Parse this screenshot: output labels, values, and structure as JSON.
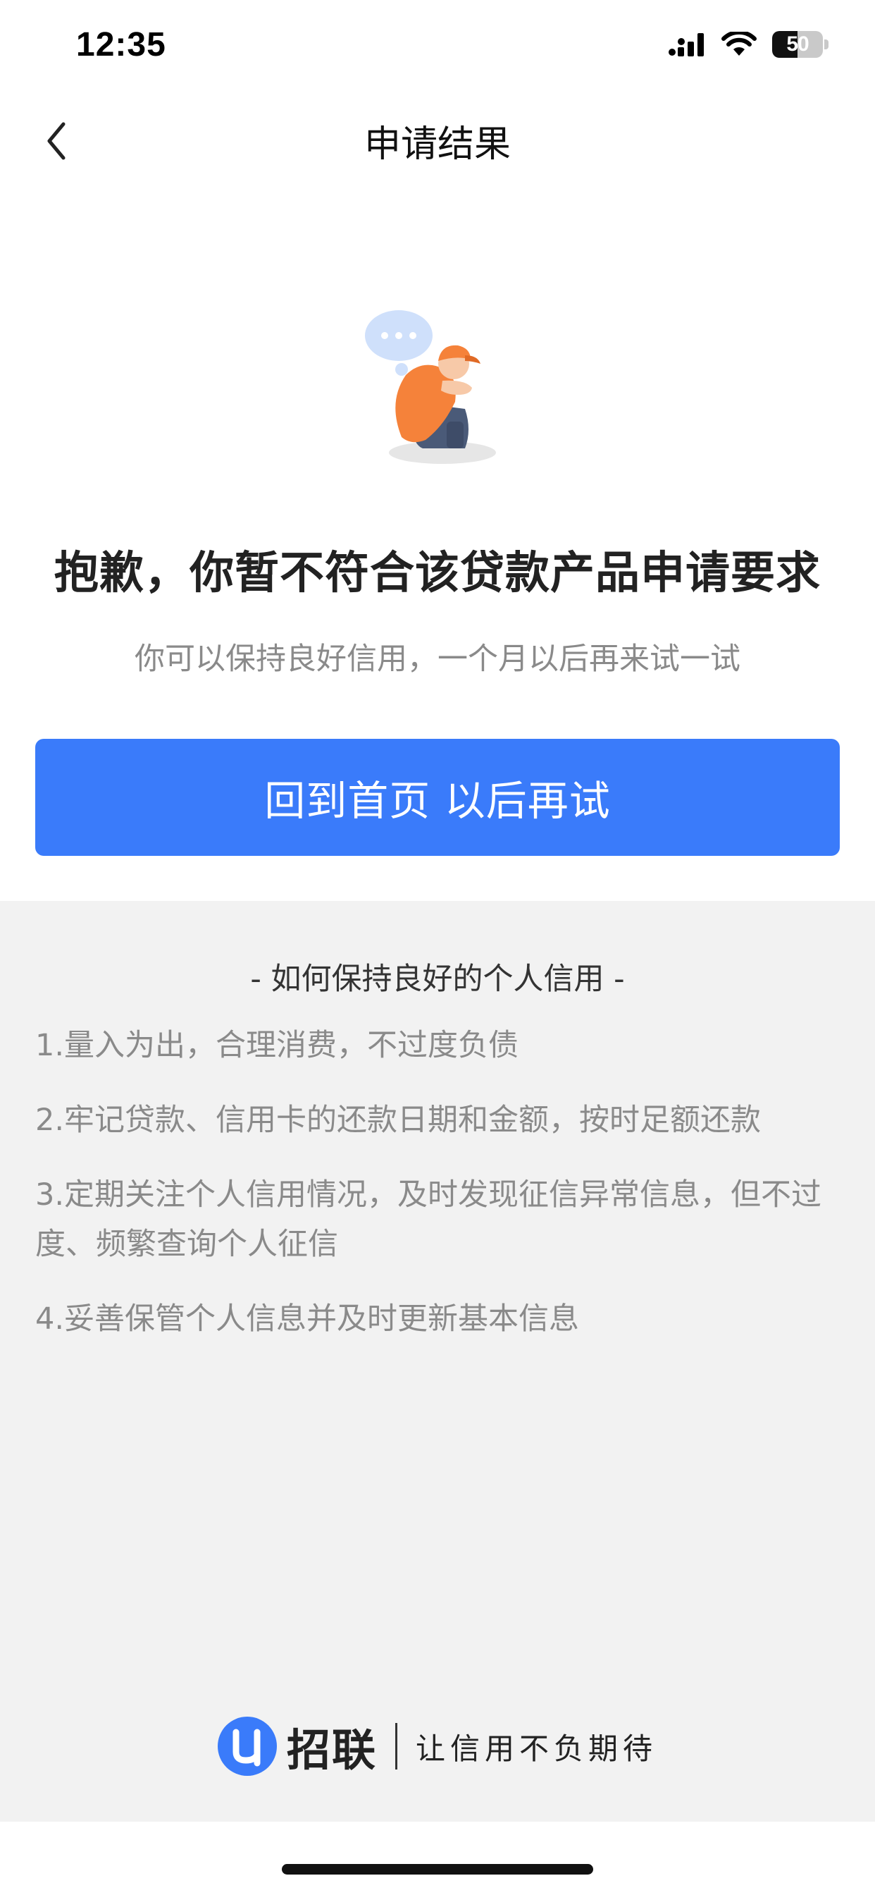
{
  "status_bar": {
    "time": "12:35",
    "battery_level": "50",
    "battery_fraction": 0.5,
    "icons": [
      "signal-icon",
      "wifi-icon",
      "battery-icon"
    ]
  },
  "nav": {
    "title": "申请结果",
    "back_icon": "chevron-left-icon"
  },
  "result": {
    "illustration": "sad-person-illustration",
    "heading": "抱歉，你暂不符合该贷款产品申请要求",
    "subtext": "你可以保持良好信用，一个月以后再来试一试",
    "button_label": "回到首页 以后再试"
  },
  "tips": {
    "title": "- 如何保持良好的个人信用 -",
    "items": [
      "1.量入为出，合理消费，不过度负债",
      "2.牢记贷款、信用卡的还款日期和金额，按时足额还款",
      "3.定期关注个人信用情况，及时发现征信异常信息，但不过度、频繁查询个人征信",
      "4.妥善保管个人信息并及时更新基本信息"
    ]
  },
  "footer": {
    "brand_name": "招联",
    "slogan": "让信用不负期待"
  },
  "colors": {
    "accent": "#3a7bfa",
    "tips_background": "#f2f2f2",
    "muted_text": "#8a8a8a",
    "illustration_orange": "#f5823a",
    "illustration_bubble": "#cfe0fb"
  }
}
